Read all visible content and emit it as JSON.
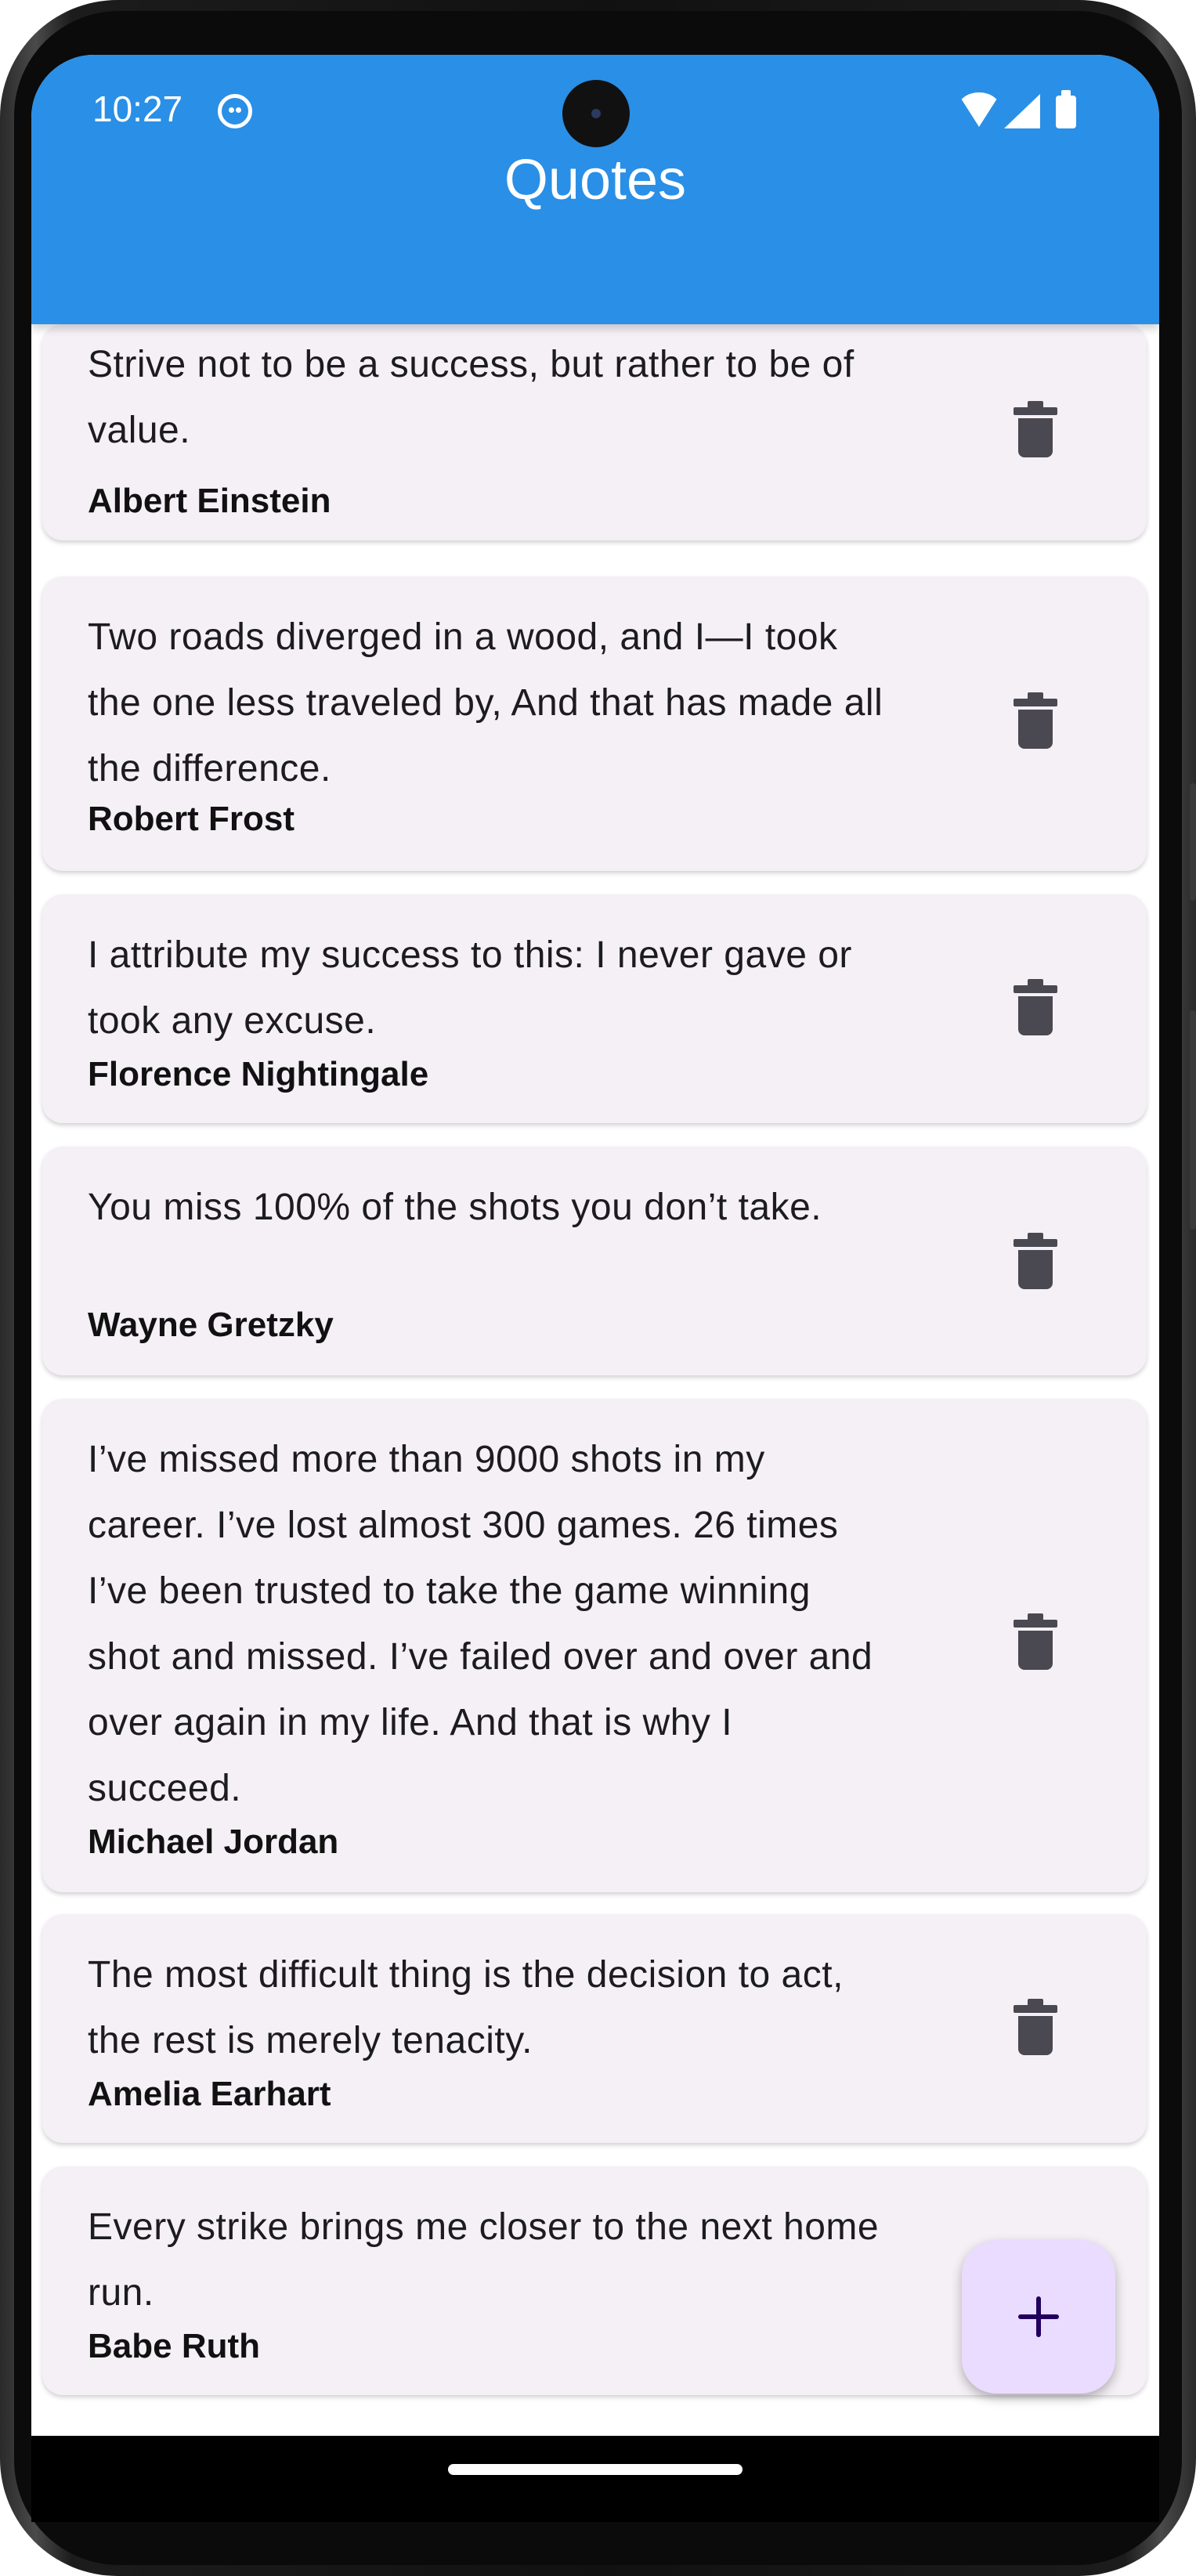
{
  "status_bar": {
    "time": "10:27"
  },
  "app_bar": {
    "title": "Quotes"
  },
  "quotes": [
    {
      "text": "Strive not to be a success, but rather to be of value.",
      "author": "Albert Einstein"
    },
    {
      "text": "Two roads diverged in a wood, and I—I took the one less traveled by, And that has made all the difference.",
      "author": "Robert Frost"
    },
    {
      "text": "I attribute my success to this: I never gave or took any excuse.",
      "author": "Florence Nightingale"
    },
    {
      "text": "You miss 100% of the shots you don’t take.",
      "author": "Wayne Gretzky"
    },
    {
      "text": "I’ve missed more than 9000 shots in my career. I’ve lost almost 300 games. 26 times I’ve been trusted to take the game winning shot and missed. I’ve failed over and over and over again in my life. And that is why I succeed.",
      "author": "Michael Jordan"
    },
    {
      "text": "The most difficult thing is the decision to act, the rest is merely tenacity.",
      "author": "Amelia Earhart"
    },
    {
      "text": "Every strike brings me closer to the next home run.",
      "author": "Babe Ruth"
    }
  ],
  "icons": {
    "delete": "trash-icon",
    "add": "plus-icon"
  },
  "colors": {
    "app_bar": "#2a8fe6",
    "card": "#f4f0f6",
    "fab": "#eadcff",
    "fab_icon": "#21005d",
    "icon": "#4a4850"
  }
}
